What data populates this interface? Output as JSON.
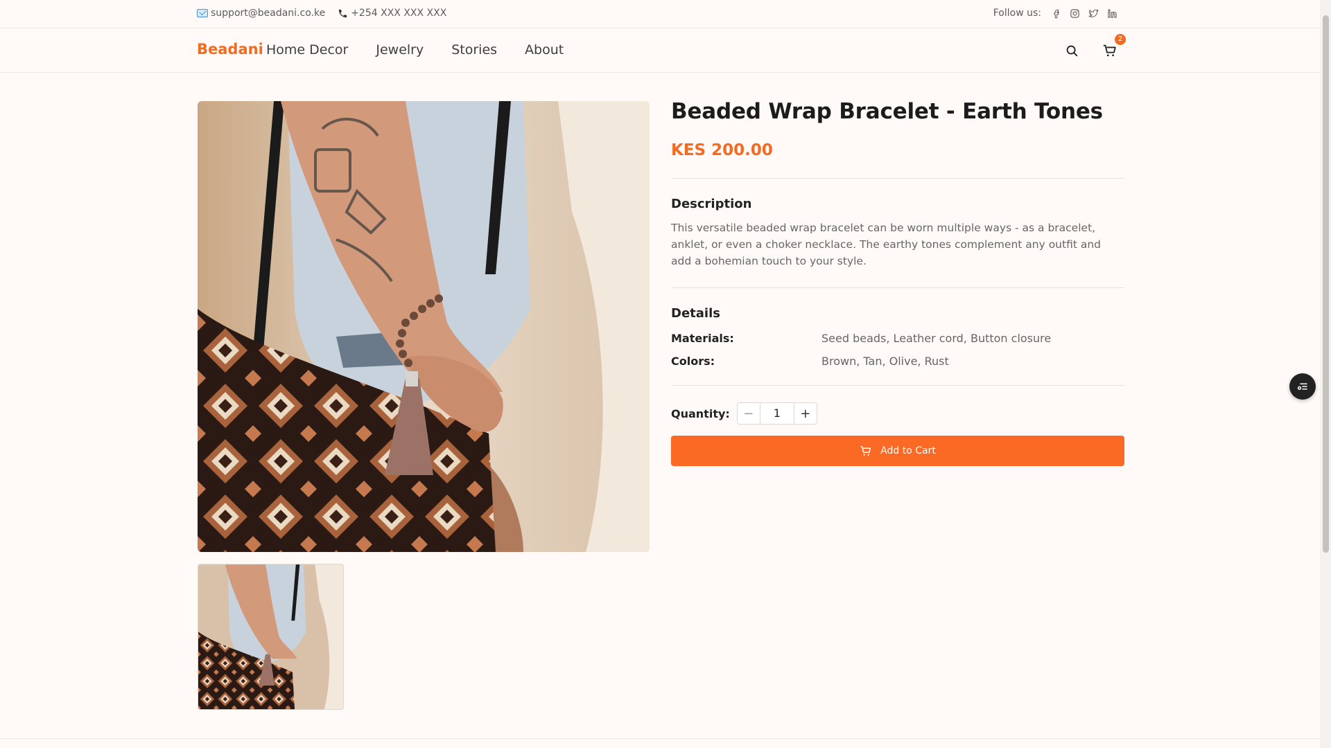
{
  "topbar": {
    "email": "support@beadani.co.ke",
    "phone": "+254 XXX XXX XXX",
    "follow_label": "Follow us:",
    "social_icons": [
      "facebook-icon",
      "instagram-icon",
      "twitter-icon",
      "linkedin-icon"
    ]
  },
  "nav": {
    "brand": "Beadani",
    "links": [
      "Home Decor",
      "Jewelry",
      "Stories",
      "About"
    ],
    "cart_count": "2"
  },
  "product": {
    "title": "Beaded Wrap Bracelet - Earth Tones",
    "price": "KES 200.00",
    "description_title": "Description",
    "description": "This versatile beaded wrap bracelet can be worn multiple ways - as a bracelet, anklet, or even a choker necklace. The earthy tones complement any outfit and add a bohemian touch to your style.",
    "details_title": "Details",
    "materials_label": "Materials:",
    "materials": "Seed beads, Leather cord, Button closure",
    "colors_label": "Colors:",
    "colors": "Brown, Tan, Olive, Rust",
    "quantity_label": "Quantity:",
    "quantity": "1",
    "add_to_cart": "Add to Cart"
  },
  "colors": {
    "accent": "#f26b21",
    "button": "#fb6a24",
    "background": "#fffaf7"
  }
}
